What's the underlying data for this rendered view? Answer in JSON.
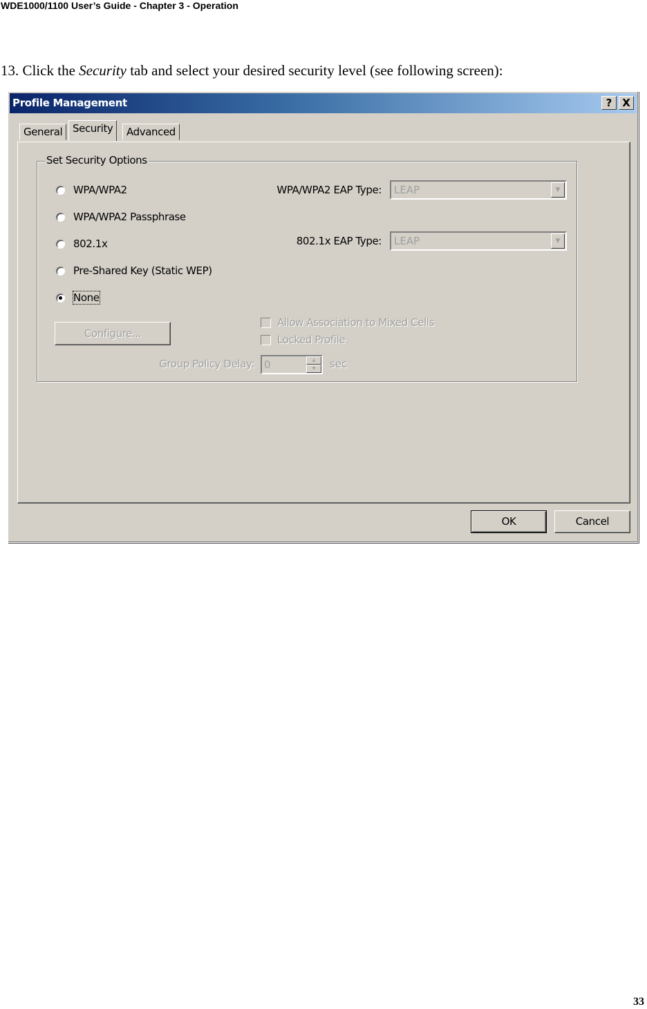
{
  "document": {
    "header": "WDE1000/1100 User’s Guide - Chapter 3 - Operation",
    "instruction_prefix": "13. Click the ",
    "instruction_emphasis": "Security",
    "instruction_suffix": " tab and select your desired security level (see following screen):",
    "page_number": "33"
  },
  "dialog": {
    "title": "Profile Management",
    "help_icon": "?",
    "close_icon": "X",
    "tabs": [
      {
        "label": "General",
        "active": false
      },
      {
        "label": "Security",
        "active": true
      },
      {
        "label": "Advanced",
        "active": false
      }
    ],
    "group_title": "Set Security Options",
    "security_options": [
      {
        "label": "WPA/WPA2",
        "selected": false
      },
      {
        "label": "WPA/WPA2 Passphrase",
        "selected": false
      },
      {
        "label": "802.1x",
        "selected": false
      },
      {
        "label": "Pre-Shared Key (Static WEP)",
        "selected": false
      },
      {
        "label": "None",
        "selected": true
      }
    ],
    "wpa_eap_label": "WPA/WPA2 EAP Type:",
    "wpa_eap_value": "LEAP",
    "dot1x_eap_label": "802.1x EAP Type:",
    "dot1x_eap_value": "LEAP",
    "configure_label": "Configure...",
    "mixed_cells_label": "Allow Association to Mixed Cells",
    "mixed_cells_checked": false,
    "locked_profile_label": "Locked Profile",
    "locked_profile_checked": false,
    "group_policy_label": "Group Policy Delay:",
    "group_policy_value": "0",
    "group_policy_unit": "sec",
    "ok_label": "OK",
    "cancel_label": "Cancel"
  }
}
